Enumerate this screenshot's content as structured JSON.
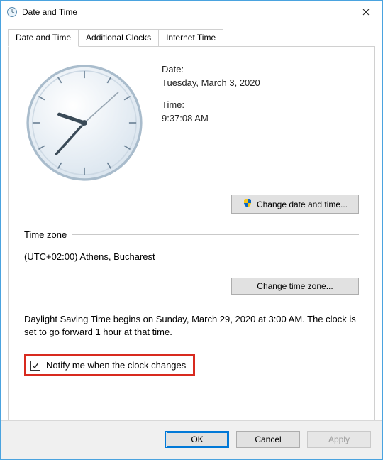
{
  "window": {
    "title": "Date and Time",
    "close_tooltip": "Close"
  },
  "tabs": {
    "date_time": "Date and Time",
    "additional_clocks": "Additional Clocks",
    "internet_time": "Internet Time"
  },
  "datetime": {
    "date_label": "Date:",
    "date_value": "Tuesday, March 3, 2020",
    "time_label": "Time:",
    "time_value": "9:37:08 AM",
    "change_button": "Change date and time..."
  },
  "timezone": {
    "section_label": "Time zone",
    "value": "(UTC+02:00) Athens, Bucharest",
    "change_button": "Change time zone..."
  },
  "dst": {
    "text": "Daylight Saving Time begins on Sunday, March 29, 2020 at 3:00 AM. The clock is set to go forward 1 hour at that time."
  },
  "notify": {
    "checked": true,
    "label": "Notify me when the clock changes"
  },
  "footer": {
    "ok": "OK",
    "cancel": "Cancel",
    "apply": "Apply"
  },
  "clock": {
    "hour": 9,
    "minute": 37,
    "second": 8
  }
}
